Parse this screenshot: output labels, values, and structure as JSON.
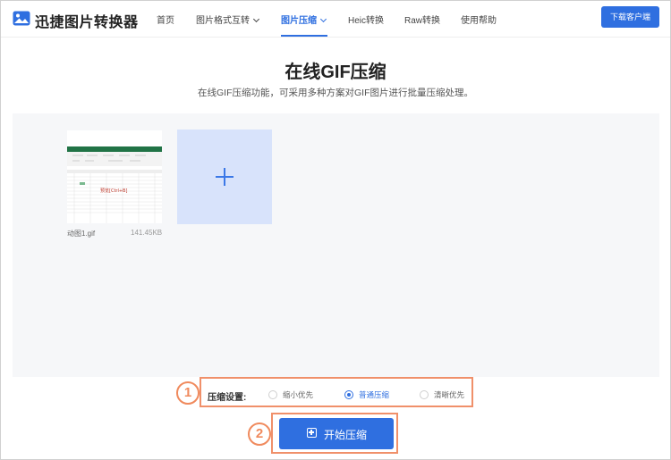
{
  "app": {
    "name": "迅捷图片转换器"
  },
  "nav": {
    "items": [
      {
        "label": "首页"
      },
      {
        "label": "图片格式互转"
      },
      {
        "label": "图片压缩"
      },
      {
        "label": "Heic转换"
      },
      {
        "label": "Raw转换"
      },
      {
        "label": "使用帮助"
      }
    ],
    "active_index": 2,
    "download_label": "下载客户端"
  },
  "page": {
    "title": "在线GIF压缩",
    "subtitle": "在线GIF压缩功能，可采用多种方案对GIF图片进行批量压缩处理。"
  },
  "files": [
    {
      "name": "动图1.gif",
      "size": "141.45KB",
      "preview_text": "预览[Ctrl+B]"
    }
  ],
  "settings": {
    "label": "压缩设置:",
    "options": [
      {
        "label": "缩小优先",
        "checked": false
      },
      {
        "label": "普通压缩",
        "checked": true
      },
      {
        "label": "清晰优先",
        "checked": false
      }
    ]
  },
  "start_button": {
    "label": "开始压缩"
  },
  "annotations": {
    "step1": "1",
    "step2": "2"
  },
  "colors": {
    "accent": "#2f6fe0",
    "highlight": "#f0906a",
    "upload_bg": "#f6f7f9",
    "add_tile": "#d8e3fb"
  }
}
